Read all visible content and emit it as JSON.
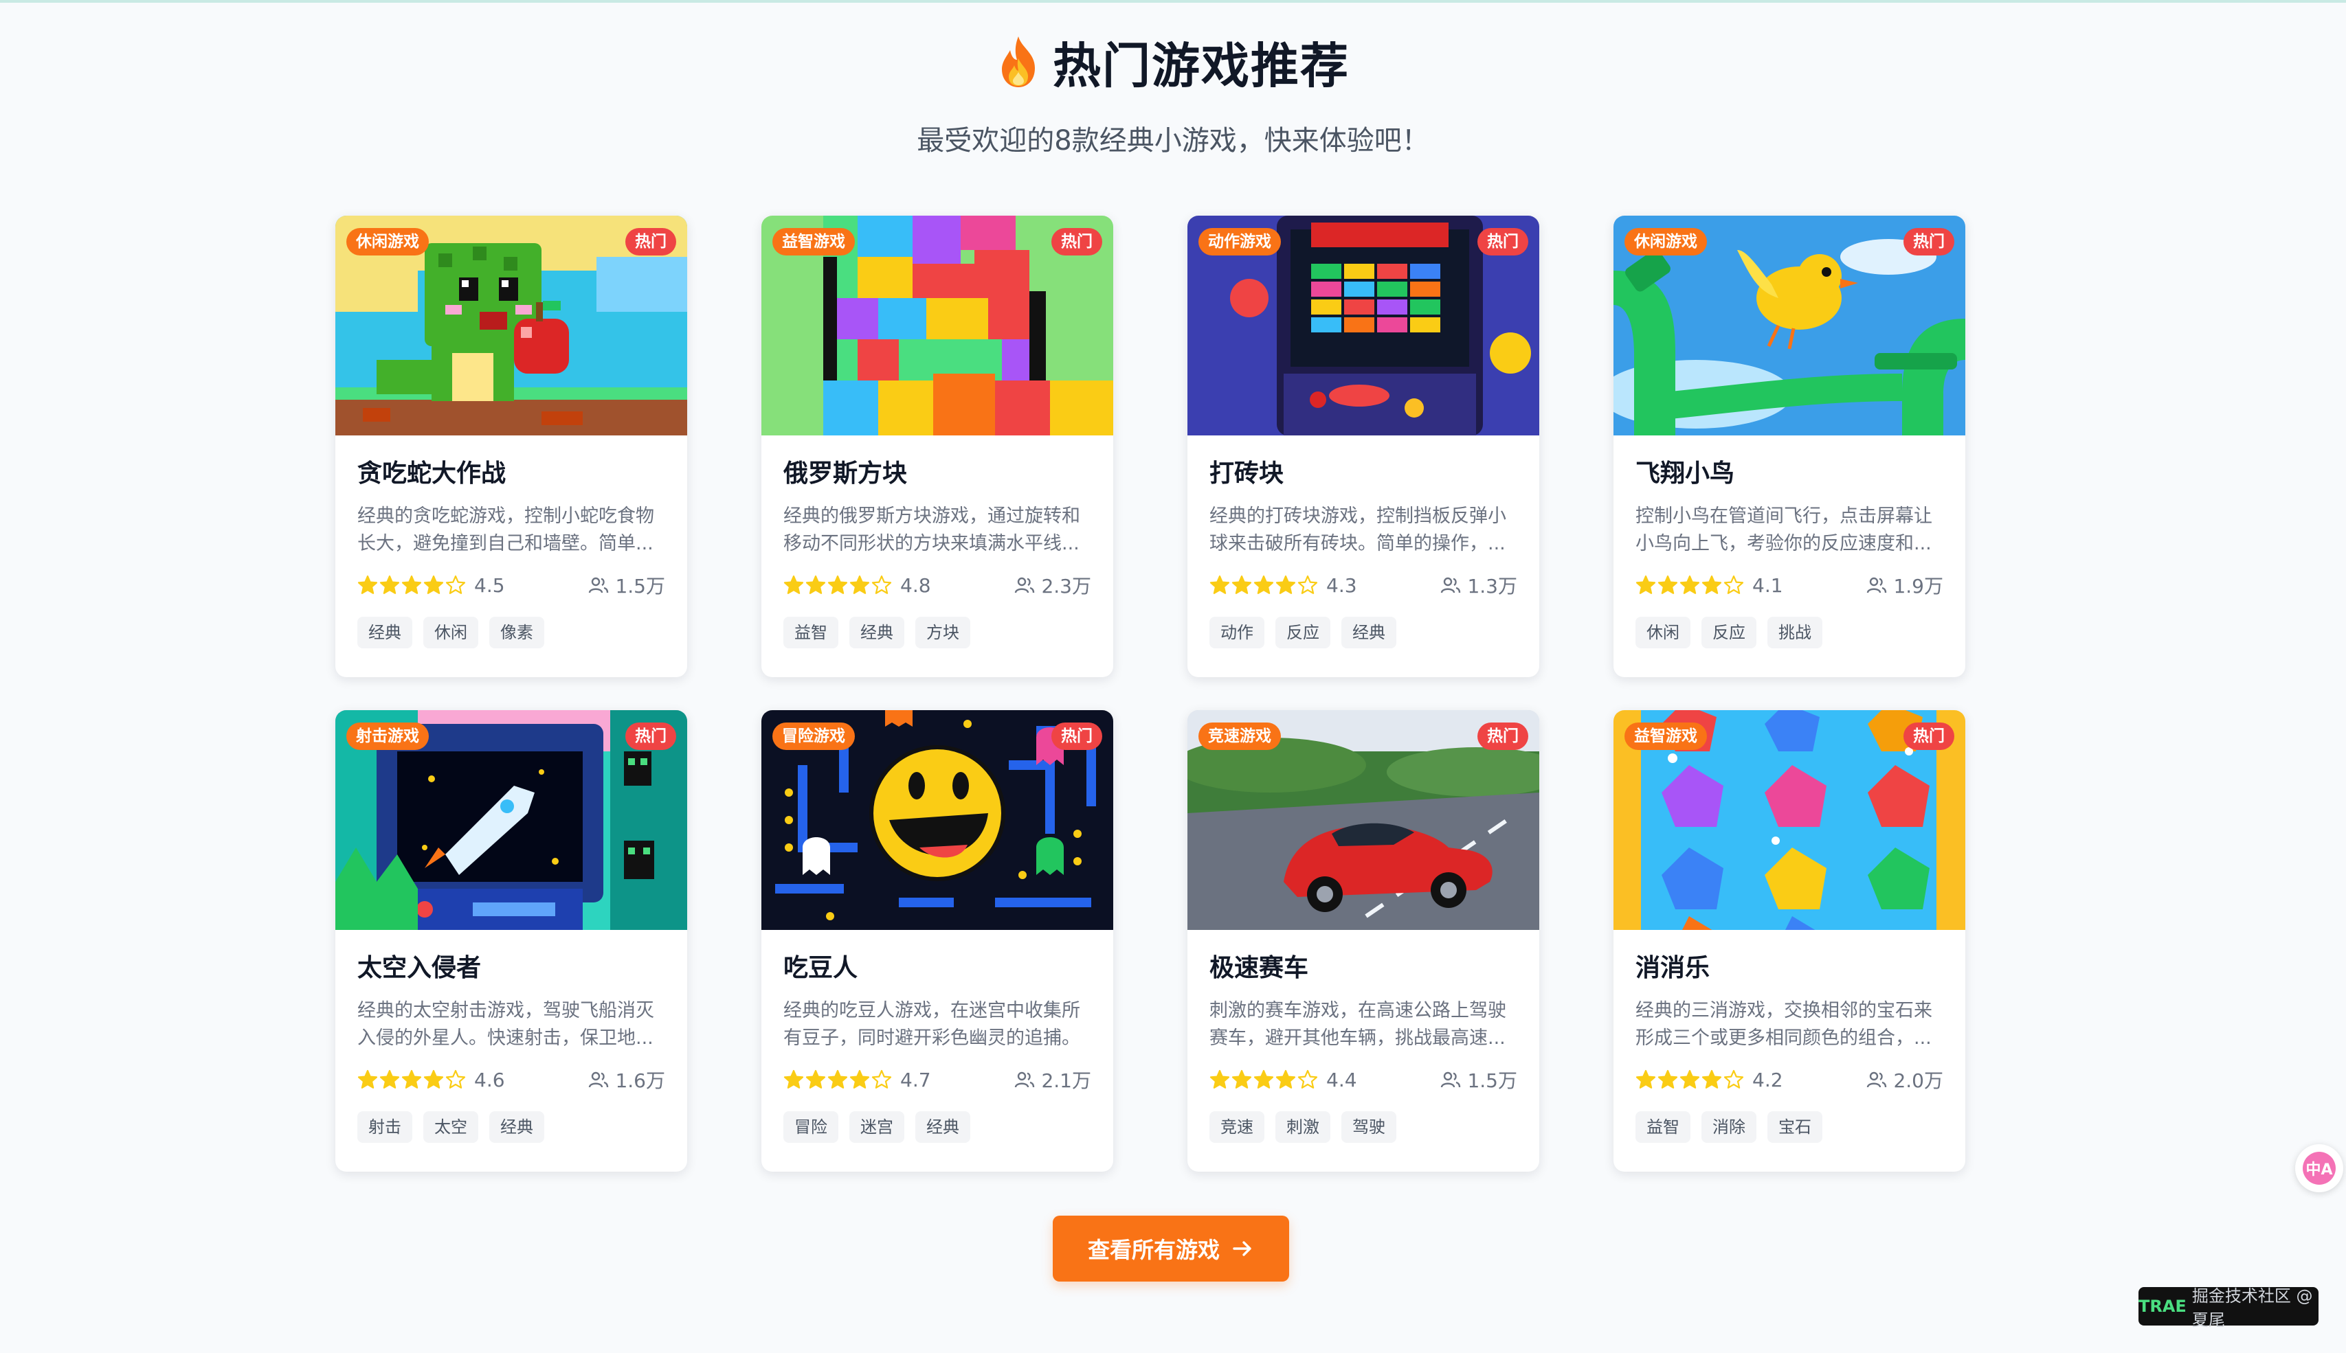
{
  "header": {
    "title": "热门游戏推荐",
    "subtitle": "最受欢迎的8款经典小游戏，快来体验吧！",
    "icon": "fire-icon"
  },
  "hot_label": "热门",
  "games": [
    {
      "category": "休闲游戏",
      "title": "贪吃蛇大作战",
      "desc": "经典的贪吃蛇游戏，控制小蛇吃食物长大，避免撞到自己和墙壁。简单...",
      "rating": "4.5",
      "rating_value": 4.5,
      "players": "1.5万",
      "tags": [
        "经典",
        "休闲",
        "像素"
      ]
    },
    {
      "category": "益智游戏",
      "title": "俄罗斯方块",
      "desc": "经典的俄罗斯方块游戏，通过旋转和移动不同形状的方块来填满水平线...",
      "rating": "4.8",
      "rating_value": 4.8,
      "players": "2.3万",
      "tags": [
        "益智",
        "经典",
        "方块"
      ]
    },
    {
      "category": "动作游戏",
      "title": "打砖块",
      "desc": "经典的打砖块游戏，控制挡板反弹小球来击破所有砖块。简单的操作，...",
      "rating": "4.3",
      "rating_value": 4.3,
      "players": "1.3万",
      "tags": [
        "动作",
        "反应",
        "经典"
      ]
    },
    {
      "category": "休闲游戏",
      "title": "飞翔小鸟",
      "desc": "控制小鸟在管道间飞行，点击屏幕让小鸟向上飞，考验你的反应速度和...",
      "rating": "4.1",
      "rating_value": 4.1,
      "players": "1.9万",
      "tags": [
        "休闲",
        "反应",
        "挑战"
      ]
    },
    {
      "category": "射击游戏",
      "title": "太空入侵者",
      "desc": "经典的太空射击游戏，驾驶飞船消灭入侵的外星人。快速射击，保卫地...",
      "rating": "4.6",
      "rating_value": 4.6,
      "players": "1.6万",
      "tags": [
        "射击",
        "太空",
        "经典"
      ]
    },
    {
      "category": "冒险游戏",
      "title": "吃豆人",
      "desc": "经典的吃豆人游戏，在迷宫中收集所有豆子，同时避开彩色幽灵的追捕。",
      "rating": "4.7",
      "rating_value": 4.7,
      "players": "2.1万",
      "tags": [
        "冒险",
        "迷宫",
        "经典"
      ]
    },
    {
      "category": "竞速游戏",
      "title": "极速赛车",
      "desc": "刺激的赛车游戏，在高速公路上驾驶赛车，避开其他车辆，挑战最高速...",
      "rating": "4.4",
      "rating_value": 4.4,
      "players": "1.5万",
      "tags": [
        "竞速",
        "刺激",
        "驾驶"
      ]
    },
    {
      "category": "益智游戏",
      "title": "消消乐",
      "desc": "经典的三消游戏，交换相邻的宝石来形成三个或更多相同颜色的组合，...",
      "rating": "4.2",
      "rating_value": 4.2,
      "players": "2.0万",
      "tags": [
        "益智",
        "消除",
        "宝石"
      ]
    }
  ],
  "view_all_label": "查看所有游戏",
  "translate_label": "中A",
  "watermark": {
    "logo": "TRAE",
    "text": "掘金技术社区 @ 夏尾"
  },
  "colors": {
    "accent": "#f97316",
    "hot": "#ef4444",
    "star": "#facc15"
  }
}
